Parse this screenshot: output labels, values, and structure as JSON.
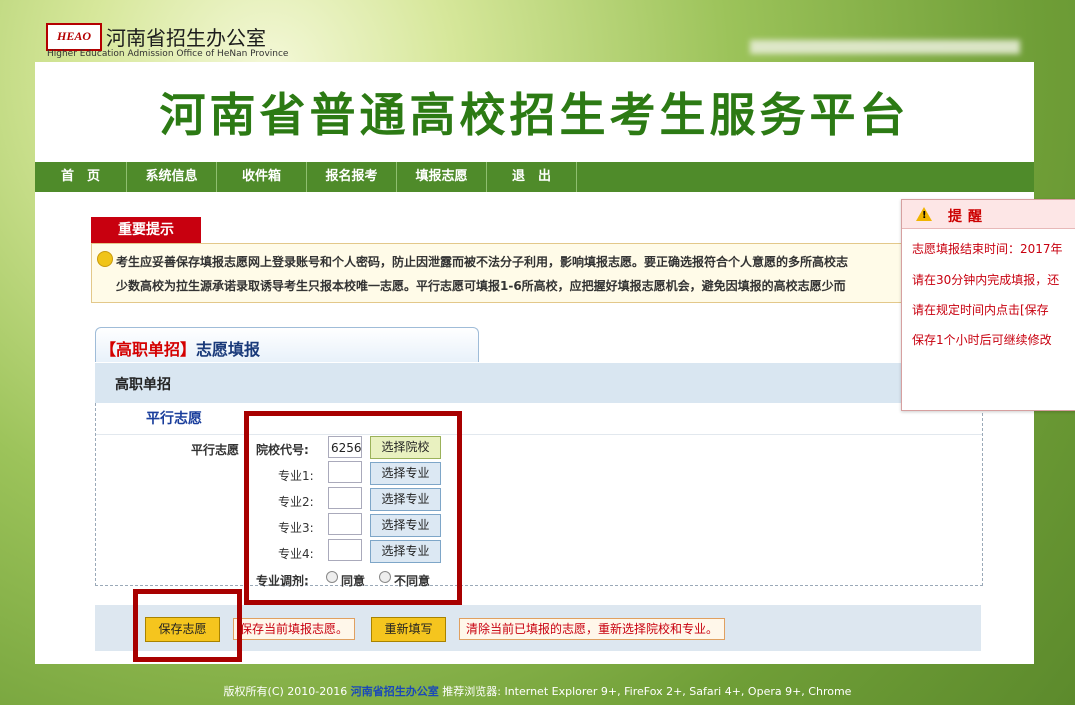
{
  "header": {
    "logo_mark": "HEAO",
    "logo_cn": "河南省招生办公室",
    "logo_en": "Higher Education Admission Office of HeNan Province"
  },
  "banner": {
    "title": "河南省普通高校招生考生服务平台"
  },
  "nav": [
    {
      "label": "首　页"
    },
    {
      "label": "系统信息"
    },
    {
      "label": "收件箱"
    },
    {
      "label": "报名报考"
    },
    {
      "label": "填报志愿"
    },
    {
      "label": "退　出"
    }
  ],
  "notice": {
    "tab": "重要提示",
    "line1": "考生应妥善保存填报志愿网上登录账号和个人密码，防止因泄露而被不法分子利用，影响填报志愿。要正确选报符合个人意愿的多所高校志",
    "line2": "少数高校为拉生源承诺录取诱导考生只报本校唯一志愿。平行志愿可填报1-6所高校，应把握好填报志愿机会，避免因填报的高校志愿少而"
  },
  "form": {
    "tab_red": "【高职单招】",
    "tab_blue": "志愿填报",
    "section": "高职单招",
    "pv_title": "平行志愿",
    "pv_label": "平行志愿",
    "school_label": "院校代号:",
    "school_value": "6256",
    "select_school": "选择院校",
    "majors": [
      {
        "label": "专业1:",
        "value": "",
        "button": "选择专业"
      },
      {
        "label": "专业2:",
        "value": "",
        "button": "选择专业"
      },
      {
        "label": "专业3:",
        "value": "",
        "button": "选择专业"
      },
      {
        "label": "专业4:",
        "value": "",
        "button": "选择专业"
      }
    ],
    "adjust_label": "专业调剂:",
    "agree": "同意",
    "disagree": "不同意"
  },
  "actions": {
    "save": "保存志愿",
    "save_tip": "保存当前填报志愿。",
    "reset": "重新填写",
    "reset_tip": "清除当前已填报的志愿，重新选择院校和专业。"
  },
  "popup": {
    "title": "提醒",
    "lines": [
      "志愿填报结束时间：2017年",
      "请在30分钟内完成填报，还",
      "请在规定时间内点击[保存",
      "保存1个小时后可继续修改"
    ]
  },
  "footer": {
    "copyright": "版权所有(C) 2010-2016",
    "org": "河南省招生办公室",
    "browsers": "推荐浏览器: Internet Explorer 9+, FireFox 2+, Safari 4+, Opera 9+, Chrome"
  }
}
